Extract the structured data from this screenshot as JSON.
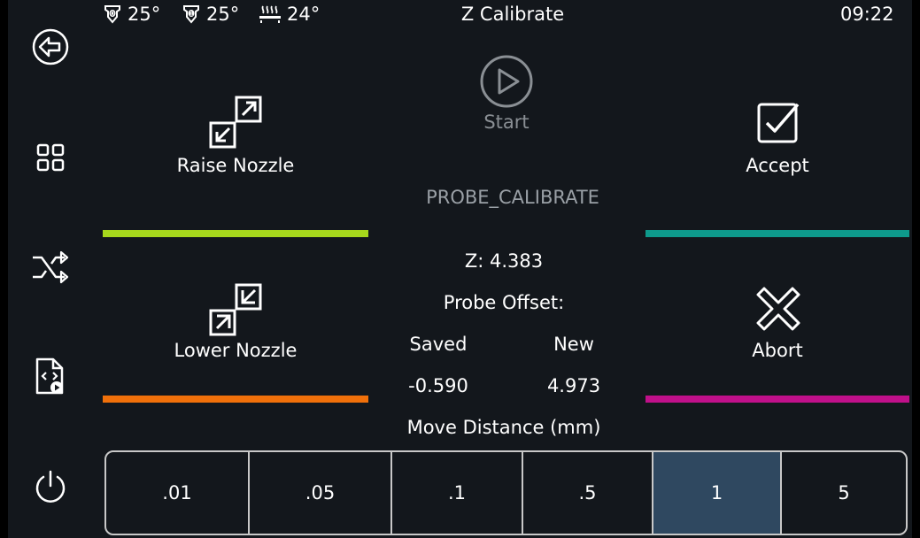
{
  "status_bar": {
    "extruder0_temp": "25°",
    "extruder1_temp": "25°",
    "bed_temp": "24°",
    "title": "Z Calibrate",
    "time": "09:22"
  },
  "sidebar": {
    "items": [
      {
        "name": "back",
        "icon": "back-arrow-icon"
      },
      {
        "name": "menu",
        "icon": "grid-icon"
      },
      {
        "name": "move",
        "icon": "shuffle-icon"
      },
      {
        "name": "macros",
        "icon": "file-code-icon"
      },
      {
        "name": "power",
        "icon": "power-icon"
      }
    ]
  },
  "actions": {
    "start_label": "Start",
    "raise_label": "Raise Nozzle",
    "lower_label": "Lower Nozzle",
    "accept_label": "Accept",
    "abort_label": "Abort",
    "method": "PROBE_CALIBRATE"
  },
  "readout": {
    "z": "Z: 4.383",
    "probe_offset_label": "Probe Offset:",
    "saved_label": "Saved",
    "new_label": "New",
    "saved_value": "-0.590",
    "new_value": "4.973"
  },
  "distance": {
    "label": "Move Distance (mm)",
    "options": [
      ".01",
      ".05",
      ".1",
      ".5",
      "1",
      "5"
    ],
    "selected": "1"
  },
  "colors": {
    "background": "#13171c",
    "raise_bar": "#a6d81c",
    "lower_bar": "#f0700a",
    "accept_bar": "#0e9a8c",
    "abort_bar": "#c0108a",
    "selected_segment": "#2f4860",
    "disabled": "#8a8f94"
  }
}
